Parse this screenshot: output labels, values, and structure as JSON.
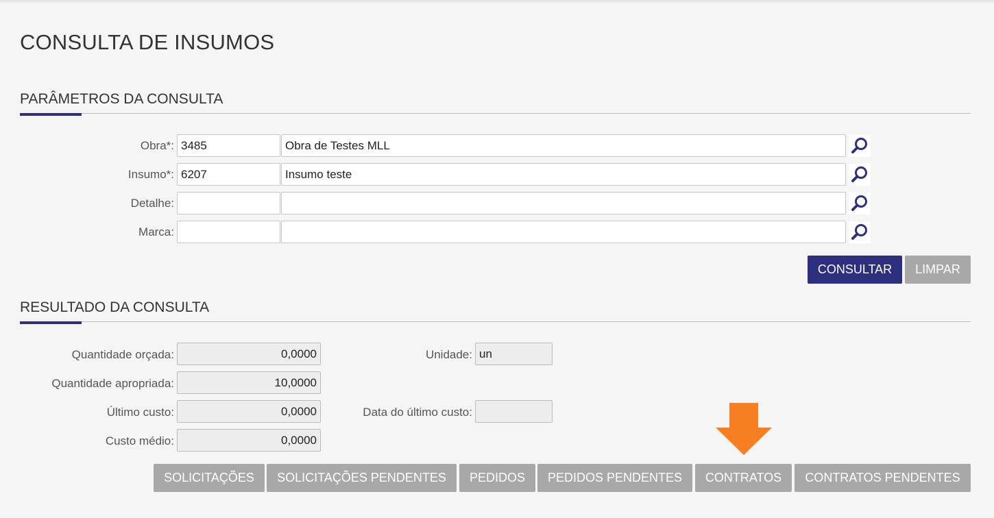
{
  "page": {
    "title": "CONSULTA DE INSUMOS"
  },
  "params": {
    "section_title": "PARÂMETROS DA CONSULTA",
    "fields": [
      {
        "label": "Obra*:",
        "code": "3485",
        "description": "Obra de Testes MLL",
        "lookup_icon": "search-icon"
      },
      {
        "label": "Insumo*:",
        "code": "6207",
        "description": "Insumo teste",
        "lookup_icon": "search-icon"
      },
      {
        "label": "Detalhe:",
        "code": "",
        "description": "",
        "lookup_icon": "search-icon"
      },
      {
        "label": "Marca:",
        "code": "",
        "description": "",
        "lookup_icon": "search-icon"
      }
    ],
    "consult_button": "CONSULTAR",
    "clear_button": "LIMPAR"
  },
  "results": {
    "section_title": "RESULTADO DA CONSULTA",
    "qtd_orcada": {
      "label": "Quantidade orçada:",
      "value": "0,0000"
    },
    "qtd_apropriada": {
      "label": "Quantidade apropriada:",
      "value": "10,0000"
    },
    "ultimo_custo": {
      "label": "Último custo:",
      "value": "0,0000"
    },
    "custo_medio": {
      "label": "Custo médio:",
      "value": "0,0000"
    },
    "unidade": {
      "label": "Unidade:",
      "value": "un"
    },
    "data_ultimo_custo": {
      "label": "Data do último custo:",
      "value": ""
    }
  },
  "actions": {
    "buttons": [
      "SOLICITAÇÕES",
      "SOLICITAÇÕES PENDENTES",
      "PEDIDOS",
      "PEDIDOS PENDENTES",
      "CONTRATOS",
      "CONTRATOS PENDENTES"
    ],
    "highlight_arrow_icon": "down-arrow-icon"
  },
  "colors": {
    "accent": "#2b2f7e",
    "gray_button": "#a8a8a8",
    "highlight_arrow": "#f77f22",
    "background": "#f5f5f5"
  }
}
